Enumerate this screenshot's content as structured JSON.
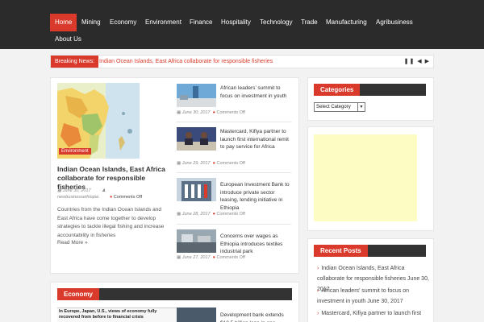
{
  "nav": {
    "items": [
      "Home",
      "Mining",
      "Economy",
      "Environment",
      "Finance",
      "Hospitality",
      "Technology",
      "Trade",
      "Manufacturing",
      "Agribusiness",
      "About Us"
    ]
  },
  "breaking": {
    "label": "Breaking News:",
    "text": "Indian Ocean Islands, East Africa collaborate for responsible fisheries",
    "controls": "❚❚ ◀ ▶"
  },
  "featured": {
    "category": "Environment",
    "title": "Indian Ocean Islands, East Africa collaborate for responsible fisheries",
    "date": "June 30, 2017",
    "author": "newbusinessethiopia",
    "comments": "Comments Off",
    "excerpt": "Countries from the Indian Ocean Islands and East Africa have come together to develop strategies to tackle illegal fishing and increase accountability in fisheries",
    "read_more": "Read More »"
  },
  "side_posts": [
    {
      "title": "African leaders’ summit to focus on investment in youth",
      "date": "June 30, 2017",
      "comments": "Comments Off"
    },
    {
      "title": "Mastercard, Kifiya partner to launch first international remit to pay service for Africa",
      "date": "June 29, 2017",
      "comments": "Comments Off"
    },
    {
      "title": "European Investment Bank to introduce private sector leasing, lending initiative in Ethiopia",
      "date": "June 28, 2017",
      "comments": "Comments Off"
    },
    {
      "title": "Concerns over wages as Ethiopia introduces textiles industrial park",
      "date": "June 27, 2017",
      "comments": "Comments Off"
    }
  ],
  "economy": {
    "heading": "Economy",
    "preview_caption": "In Europe, Japan, U.S., views of economy fully recovered from before to financial crisis",
    "next_title": "Development bank extends $10.5 billion loan in one"
  },
  "sidebar": {
    "categories_heading": "Categories",
    "select_value": "Select Category",
    "recent_heading": "Recent Posts",
    "recent_posts": [
      "Indian Ocean Islands, East Africa collaborate for responsible fisheries June 30, 2017",
      "African leaders’ summit to focus on investment in youth June 30, 2017",
      "Mastercard, Kifiya partner to launch first"
    ]
  },
  "colors": {
    "accent": "#d93a2b",
    "nav_bg": "#2b2b2b",
    "ad_bg": "#fdfcc3"
  }
}
